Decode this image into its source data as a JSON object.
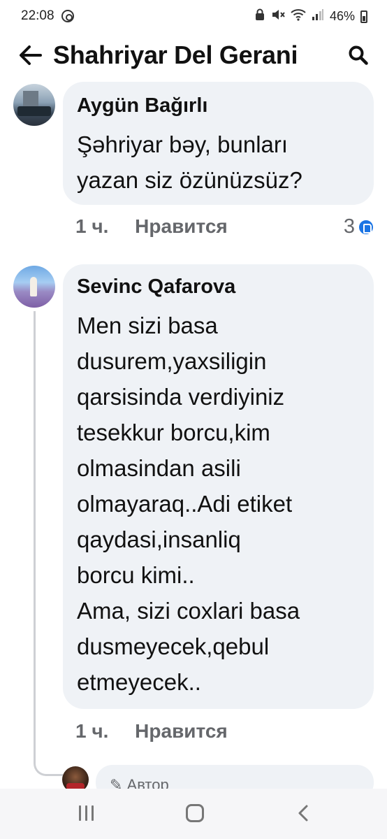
{
  "status_bar": {
    "time": "22:08",
    "battery": "46%",
    "icons": [
      "sync-icon",
      "lock-icon",
      "mute-icon",
      "wifi-icon",
      "signal-icon",
      "battery-icon"
    ]
  },
  "header": {
    "title": "Shahriyar Del Gerani",
    "back_icon": "arrow-left-icon",
    "search_icon": "search-icon"
  },
  "comments": [
    {
      "author": "Aygün Bağırlı",
      "lines": [
        "Şəhriyar bəy, bunları",
        "yazan siz özünüzsüz?"
      ],
      "time": "1 ч.",
      "like_label": "Нравится",
      "reaction_count": "3"
    },
    {
      "author": "Sevinc Qafarova",
      "lines": [
        "Men sizi basa",
        "dusurem,yaxsiligin",
        "qarsisinda verdiyiniz",
        "tesekkur borcu,kim",
        "olmasindan asili",
        "olmayaraq..Adi etiket",
        "qaydasi,insanliq",
        "borcu kimi..",
        "Ama, sizi coxlari basa",
        "dusmeyecek,qebul",
        "etmeyecek.."
      ],
      "time": "1 ч.",
      "like_label": "Нравится"
    }
  ],
  "reply_preview": {
    "label": "✎ Автор"
  },
  "colors": {
    "bubble": "#eff2f6",
    "meta_text": "#65676b",
    "like_blue": "#1b74e4"
  }
}
